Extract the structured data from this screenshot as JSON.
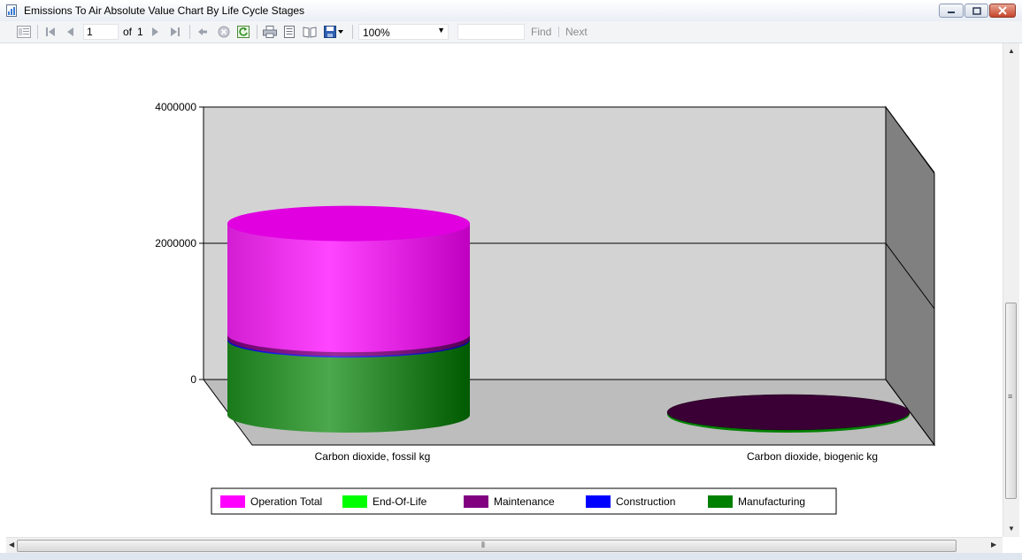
{
  "window": {
    "title": "Emissions To Air Absolute Value Chart By Life Cycle Stages",
    "icon": "report-icon"
  },
  "toolbar": {
    "page_current": "1",
    "page_of_label": "of",
    "page_total": "1",
    "zoom": "100%",
    "find_placeholder": "",
    "find_label": "Find",
    "next_label": "Next"
  },
  "chart_data": {
    "type": "bar",
    "stacked": true,
    "style": "3d-cylinder",
    "categories": [
      "Carbon dioxide, fossil kg",
      "Carbon dioxide, biogenic kg"
    ],
    "series": [
      {
        "name": "Manufacturing",
        "color": "#008000",
        "values": [
          1100000,
          0
        ]
      },
      {
        "name": "Construction",
        "color": "#0000ff",
        "values": [
          20000,
          0
        ]
      },
      {
        "name": "Maintenance",
        "color": "#800080",
        "values": [
          60000,
          0
        ]
      },
      {
        "name": "End-Of-Life",
        "color": "#00ff00",
        "values": [
          0,
          0
        ]
      },
      {
        "name": "Operation Total",
        "color": "#ff00ff",
        "values": [
          1630000,
          0
        ]
      }
    ],
    "legend_order": [
      "Operation Total",
      "End-Of-Life",
      "Maintenance",
      "Construction",
      "Manufacturing"
    ],
    "yticks": [
      0,
      2000000,
      4000000
    ],
    "ytick_labels": [
      "0",
      "2000000",
      "4000000"
    ],
    "ylim": [
      0,
      4000000
    ],
    "grid": true,
    "legend_position": "bottom",
    "title": "",
    "xlabel": "",
    "ylabel": ""
  }
}
